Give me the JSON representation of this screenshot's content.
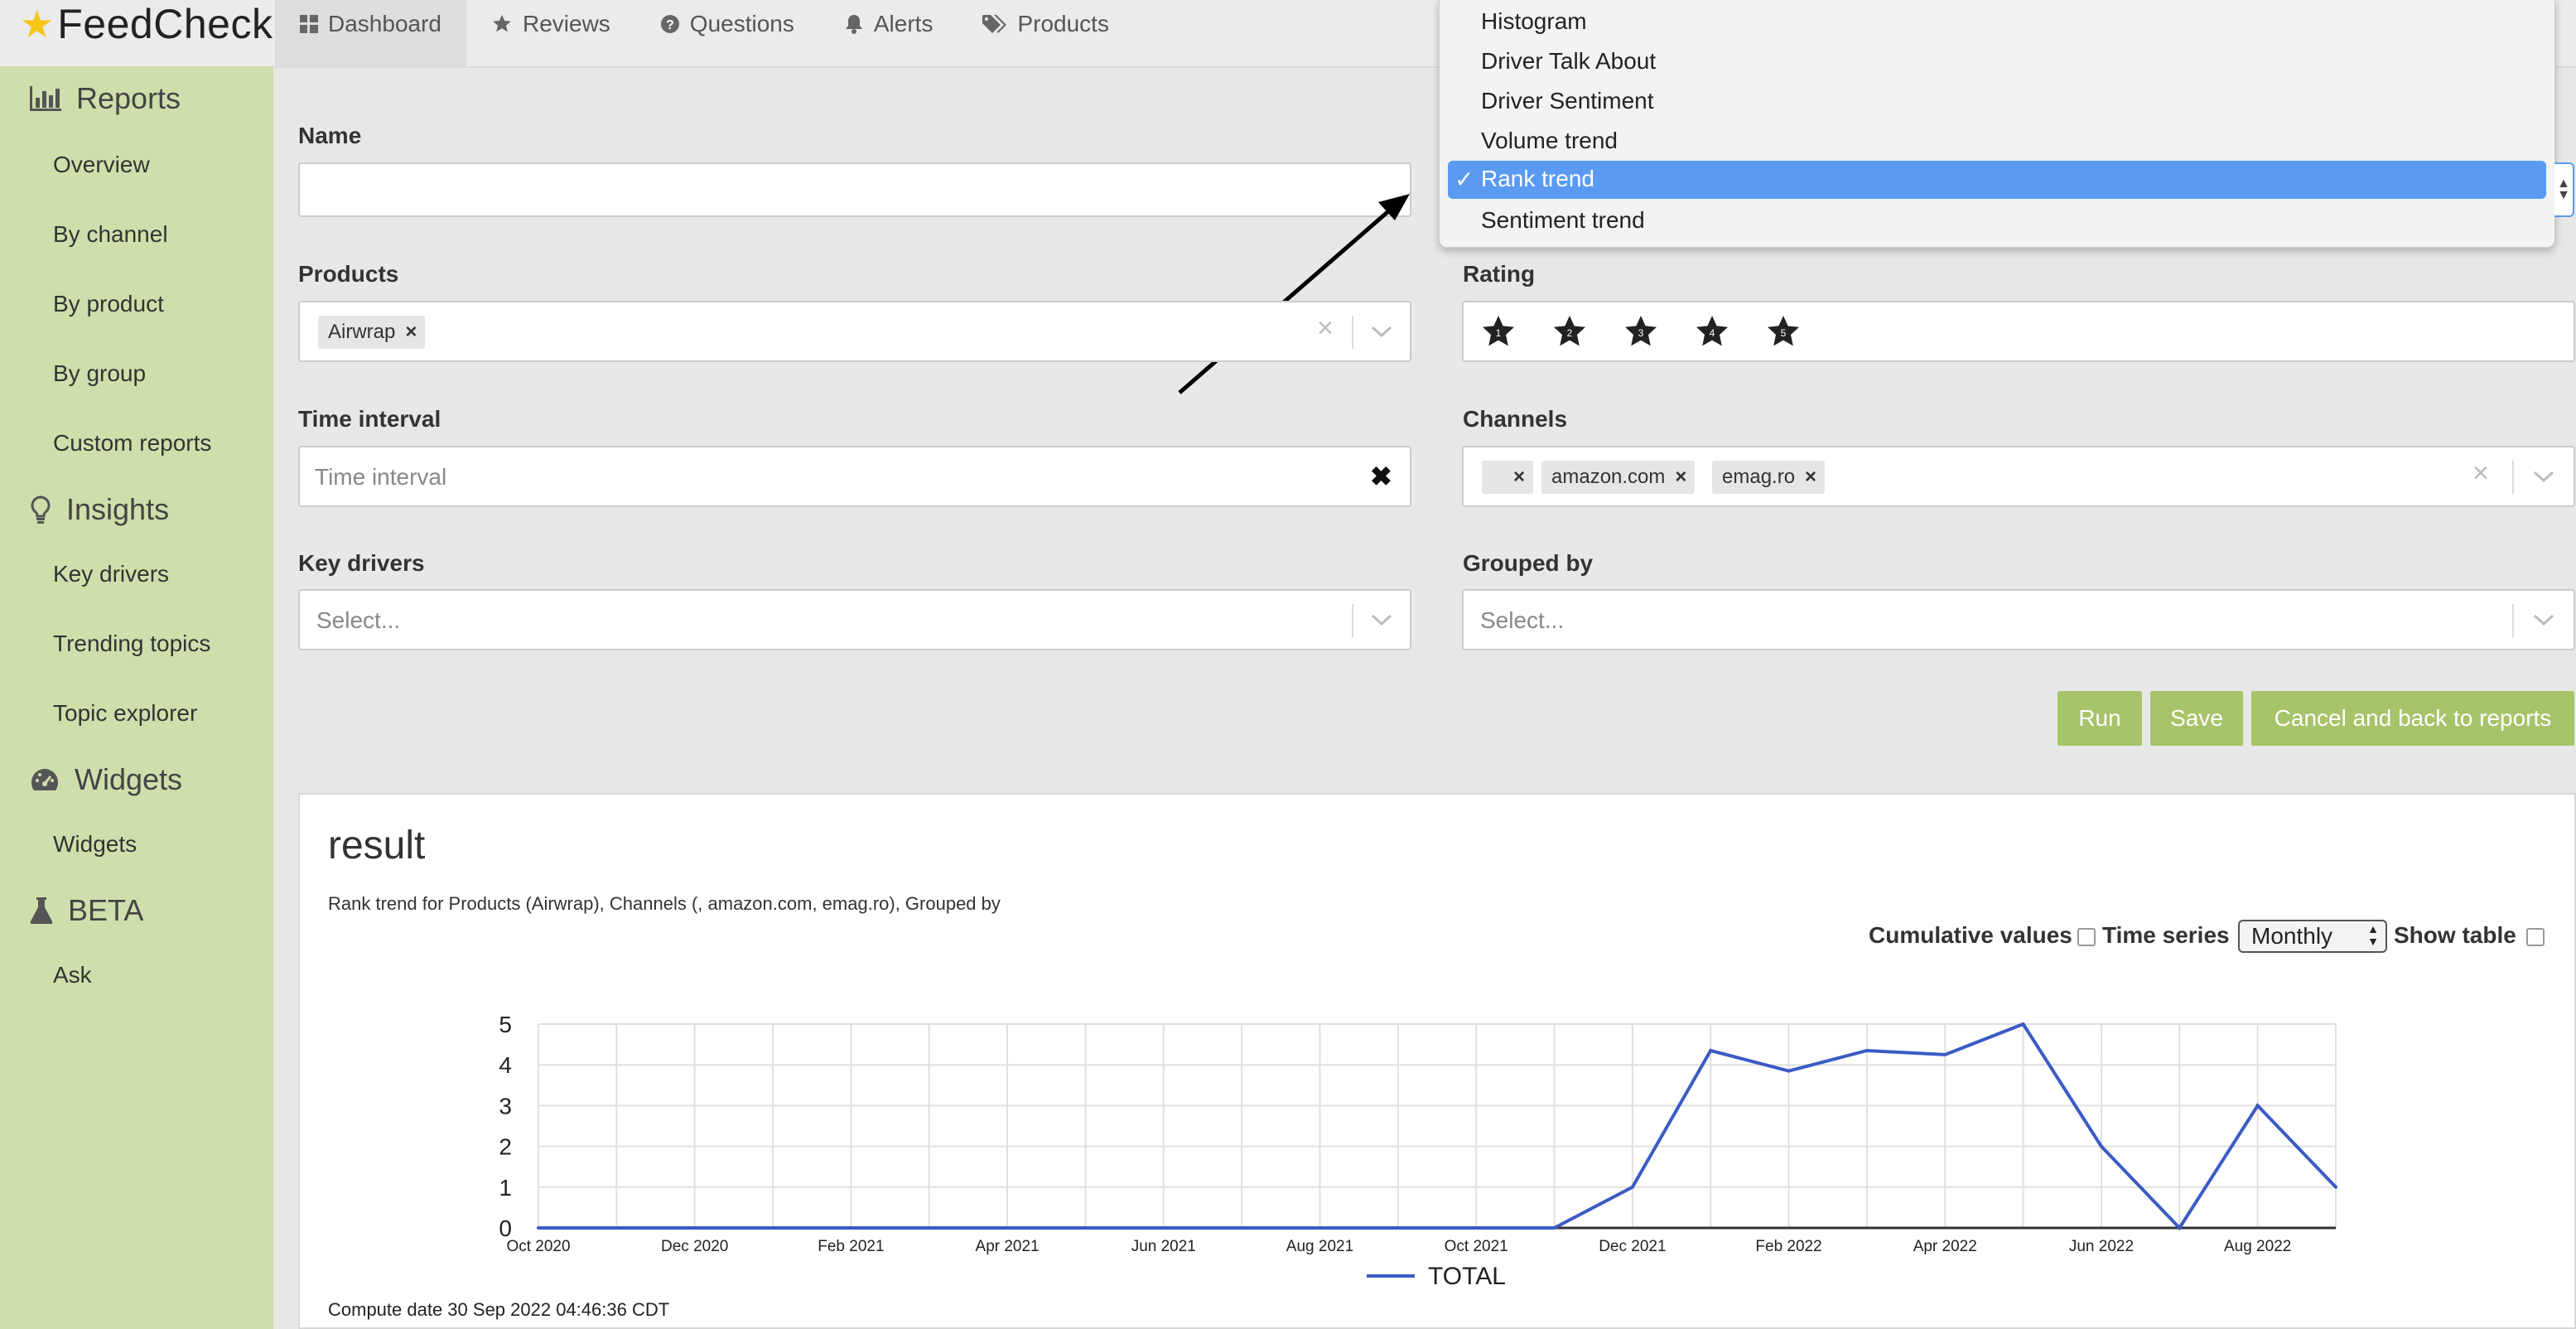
{
  "brand": {
    "name": "FeedCheck"
  },
  "nav": [
    {
      "label": "Dashboard",
      "icon": "dashboard-icon"
    },
    {
      "label": "Reviews",
      "icon": "star-icon"
    },
    {
      "label": "Questions",
      "icon": "question-icon"
    },
    {
      "label": "Alerts",
      "icon": "bell-icon"
    },
    {
      "label": "Products",
      "icon": "tags-icon"
    }
  ],
  "sidebar": {
    "sections": [
      {
        "label": "Reports",
        "icon": "bar-chart-icon",
        "items": [
          "Overview",
          "By channel",
          "By product",
          "By group",
          "Custom reports"
        ]
      },
      {
        "label": "Insights",
        "icon": "lightbulb-icon",
        "items": [
          "Key drivers",
          "Trending topics",
          "Topic explorer"
        ]
      },
      {
        "label": "Widgets",
        "icon": "dashboard-gauge-icon",
        "items": [
          "Widgets"
        ]
      },
      {
        "label": "BETA",
        "icon": "flask-icon",
        "items": [
          "Ask"
        ]
      }
    ]
  },
  "form": {
    "name_label": "Name",
    "name_value": "",
    "products_label": "Products",
    "products_selected": [
      "Airwrap"
    ],
    "rating_label": "Rating",
    "rating_stars": [
      "1",
      "2",
      "3",
      "4",
      "5"
    ],
    "time_label": "Time interval",
    "time_placeholder": "Time interval",
    "channels_label": "Channels",
    "channels_selected": [
      "",
      "amazon.com",
      "emag.ro"
    ],
    "key_drivers_label": "Key drivers",
    "key_drivers_placeholder": "Select...",
    "grouped_label": "Grouped by",
    "grouped_placeholder": "Select..."
  },
  "report_type_dropdown": {
    "options": [
      "Histogram",
      "Driver Talk About",
      "Driver Sentiment",
      "Volume trend",
      "Rank trend",
      "Sentiment trend"
    ],
    "selected": "Rank trend",
    "check": "✓"
  },
  "buttons": {
    "run": "Run",
    "save": "Save",
    "cancel": "Cancel and back to reports"
  },
  "result": {
    "title": "result",
    "description": "Rank trend for Products (Airwrap), Channels (, amazon.com, emag.ro), Grouped by",
    "cumulative_label": "Cumulative values",
    "time_series_label": "Time series",
    "time_series_value": "Monthly",
    "show_table_label": "Show table",
    "compute_date": "Compute date 30 Sep 2022 04:46:36 CDT"
  },
  "chart_data": {
    "type": "line",
    "x": [
      "Oct 2020",
      "Nov 2020",
      "Dec 2020",
      "Jan 2021",
      "Feb 2021",
      "Mar 2021",
      "Apr 2021",
      "May 2021",
      "Jun 2021",
      "Jul 2021",
      "Aug 2021",
      "Sep 2021",
      "Oct 2021",
      "Nov 2021",
      "Dec 2021",
      "Jan 2022",
      "Feb 2022",
      "Mar 2022",
      "Apr 2022",
      "May 2022",
      "Jun 2022",
      "Jul 2022",
      "Aug 2022",
      "Sep 2022"
    ],
    "x_tick_labels": [
      "Oct 2020",
      "Dec 2020",
      "Feb 2021",
      "Apr 2021",
      "Jun 2021",
      "Aug 2021",
      "Oct 2021",
      "Dec 2021",
      "Feb 2022",
      "Apr 2022",
      "Jun 2022",
      "Aug 2022"
    ],
    "series": [
      {
        "name": "TOTAL",
        "color": "#3b5bc4",
        "values": [
          0,
          0,
          0,
          0,
          0,
          0,
          0,
          0,
          0,
          0,
          0,
          0,
          0,
          0,
          1,
          4.35,
          3.85,
          4.35,
          4.25,
          5,
          2,
          0,
          3,
          1
        ]
      }
    ],
    "ylim": [
      0,
      5
    ],
    "y_ticks": [
      0,
      1,
      2,
      3,
      4,
      5
    ],
    "grid": true,
    "legend": "bottom"
  },
  "colors": {
    "sidebar": "#cfdfab",
    "button": "#a7c46a",
    "selection": "#5a9af0",
    "line": "#3b5bc4"
  }
}
